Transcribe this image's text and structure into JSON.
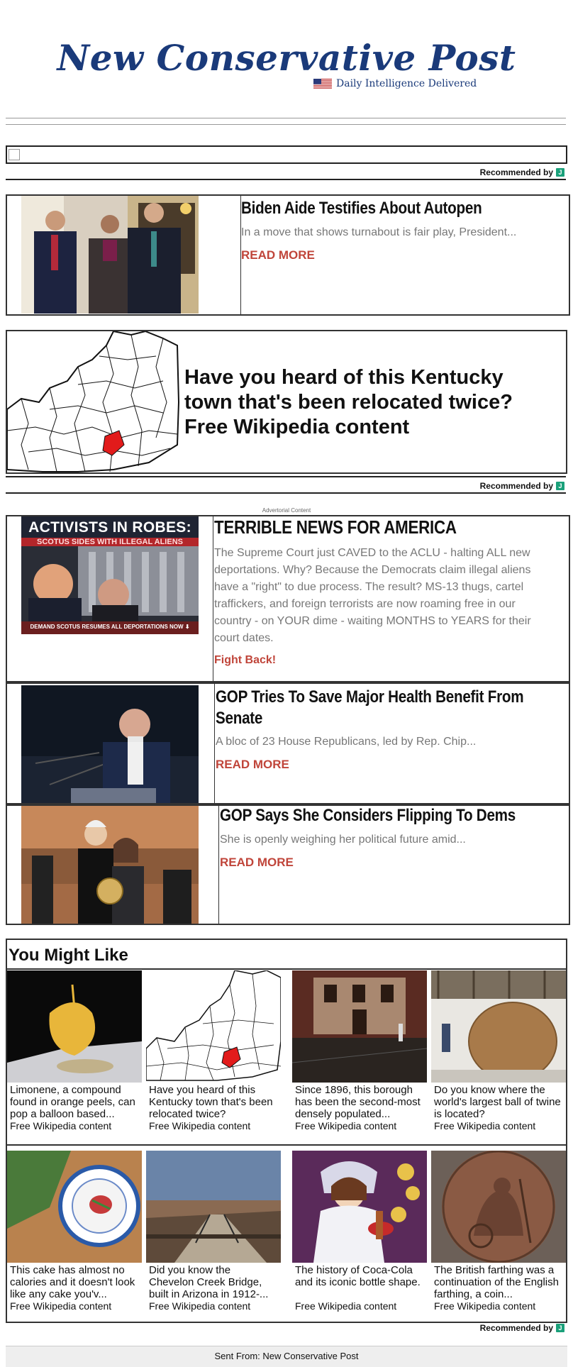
{
  "masthead": {
    "title": "New Conservative Post",
    "tagline": "Daily Intelligence Delivered"
  },
  "recommended_label": "Recommended by",
  "recommended_badge": "J",
  "articles": [
    {
      "headline": "Biden Aide Testifies About Autopen",
      "teaser": "In a move that shows turnabout is fair play, President...",
      "cta": "READ MORE"
    },
    {
      "headline": "TERRIBLE NEWS FOR AMERICA",
      "teaser": "The Supreme Court just CAVED to the ACLU - halting ALL new deportations. Why? Because the Democrats claim illegal aliens have a \"right\" to due process. The result?  MS-13 thugs, cartel traffickers, and foreign terrorists are now roaming free in our country - on YOUR dime - waiting MONTHS to YEARS for their court dates.",
      "cta": "Fight Back!",
      "image_text": {
        "top": "ACTIVISTS IN ROBES:",
        "sub": "SCOTUS SIDES WITH ILLEGAL ALIENS",
        "bottom": "DEMAND SCOTUS RESUMES ALL DEPORTATIONS NOW ⬇"
      }
    },
    {
      "headline": "GOP Tries To Save Major Health Benefit From Senate",
      "teaser": "A bloc of 23 House Republicans, led by Rep. Chip...",
      "cta": "READ MORE"
    },
    {
      "headline": "GOP Says She Considers Flipping To Dems",
      "teaser": "She is openly weighing her political future amid...",
      "cta": "READ MORE"
    }
  ],
  "kentucky_ad": {
    "text": "Have you heard of this Kentucky town that's been relocated twice? Free Wikipedia content"
  },
  "advertorial_label": "Advertorial Content",
  "you_might_like": {
    "title": "You Might Like",
    "items": [
      {
        "caption": "Limonene, a compound found in orange peels, can pop a balloon based...",
        "source": "Free Wikipedia content"
      },
      {
        "caption": "Have you heard of this Kentucky town that's been relocated twice?",
        "source": "Free Wikipedia content"
      },
      {
        "caption": "Since 1896, this borough has been the second-most densely populated...",
        "source": "Free Wikipedia content"
      },
      {
        "caption": "Do you know where the world's largest ball of twine is located?",
        "source": "Free Wikipedia content"
      },
      {
        "caption": "This cake has almost no calories and it doesn't look like any cake you'v...",
        "source": "Free Wikipedia content"
      },
      {
        "caption": "Did you know the Chevelon Creek Bridge, built in Arizona in 1912-...",
        "source": "Free Wikipedia content"
      },
      {
        "caption": "The history of Coca-Cola and its iconic bottle shape.",
        "source": "Free Wikipedia content"
      },
      {
        "caption": "The British farthing was a continuation of the English farthing, a coin...",
        "source": "Free Wikipedia content"
      }
    ]
  },
  "footer": {
    "text": "Sent From: New Conservative Post"
  },
  "colors": {
    "brand": "#1a3a7a",
    "cta": "#c0453a",
    "teaser": "#777777"
  }
}
